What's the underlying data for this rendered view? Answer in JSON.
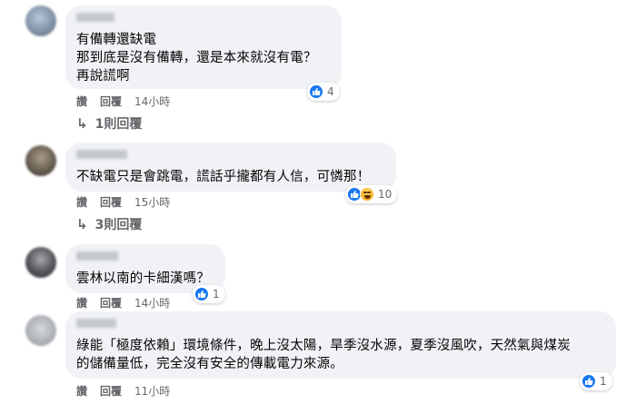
{
  "comments": [
    {
      "lines": [
        "有備轉還缺電",
        "那到底是沒有備轉，還是本來就沒有電？",
        "再說謊啊"
      ],
      "reaction_count": "4",
      "actions": {
        "like": "讚",
        "reply": "回覆",
        "time": "14小時"
      },
      "replies_label": "1則回覆"
    },
    {
      "lines": [
        "不缺電只是會跳電，謊話乎攏都有人信，可憐那！"
      ],
      "reaction_count": "10",
      "actions": {
        "like": "讚",
        "reply": "回覆",
        "time": "15小時"
      },
      "replies_label": "3則回覆"
    },
    {
      "lines": [
        "雲林以南的卡細漢嗎？"
      ],
      "reaction_count": "1",
      "actions": {
        "like": "讚",
        "reply": "回覆",
        "time": "14小時"
      }
    },
    {
      "lines": [
        "綠能「極度依賴」環境條件，晚上沒太陽，旱季沒水源，夏季沒風吹，天然氣與煤炭",
        "的儲備量低，完全沒有安全的傳載電力來源。"
      ],
      "reaction_count": "1",
      "actions": {
        "like": "讚",
        "reply": "回覆",
        "time": "11小時"
      }
    }
  ],
  "icons": {
    "like": "thumbs-up-icon",
    "haha": "haha-icon",
    "reply_arrow": "reply-arrow-icon"
  },
  "colors": {
    "like_blue": "#1877f2",
    "bubble_bg": "#f0f2f5",
    "meta_gray": "#65676b"
  }
}
